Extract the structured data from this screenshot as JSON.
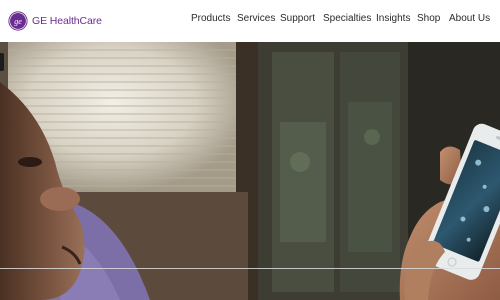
{
  "brand": {
    "name": "GE HealthCare",
    "logo_icon": "ge-monogram-icon",
    "accent_color": "#6b2c91"
  },
  "nav": {
    "items": [
      {
        "label": "Products"
      },
      {
        "label": "Services"
      },
      {
        "label": "Support"
      },
      {
        "label": "Specialties"
      },
      {
        "label": "Insights"
      },
      {
        "label": "Shop"
      },
      {
        "label": "About Us"
      }
    ]
  },
  "hero": {
    "media": "video-still",
    "scene": "person lying down looking at smartphone"
  }
}
